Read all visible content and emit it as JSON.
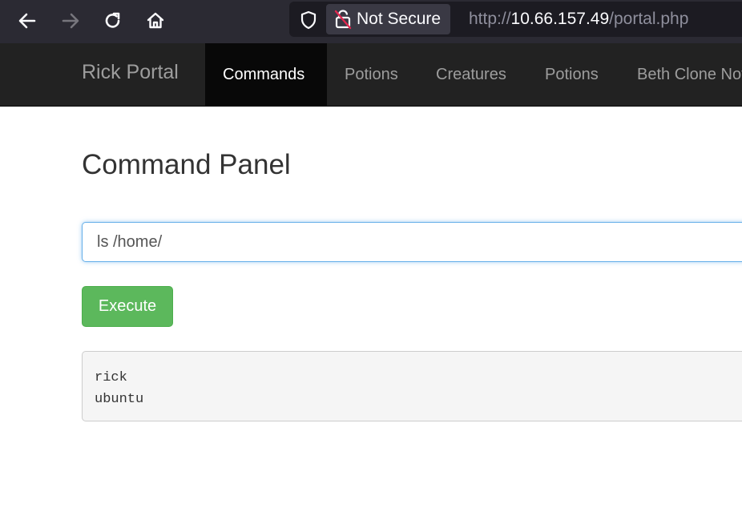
{
  "browser": {
    "security_label": "Not Secure",
    "url_scheme": "http://",
    "url_host": "10.66.157.49",
    "url_path": "/portal.php",
    "icons": [
      "back-arrow-icon",
      "forward-arrow-icon",
      "reload-icon",
      "home-icon",
      "shield-icon",
      "lock-broken-icon"
    ]
  },
  "navbar": {
    "brand": "Rick Portal",
    "items": [
      {
        "label": "Commands",
        "active": true
      },
      {
        "label": "Potions",
        "active": false
      },
      {
        "label": "Creatures",
        "active": false
      },
      {
        "label": "Potions",
        "active": false
      },
      {
        "label": "Beth Clone Notes",
        "active": false
      }
    ]
  },
  "main": {
    "title": "Command Panel",
    "command_value": "ls /home/",
    "execute_label": "Execute",
    "output_lines": [
      "rick",
      "ubuntu"
    ]
  },
  "colors": {
    "navbar_bg": "#222222",
    "active_nav_bg": "#080808",
    "execute_green": "#5cb85c",
    "input_focus_blue": "#66afe9"
  }
}
